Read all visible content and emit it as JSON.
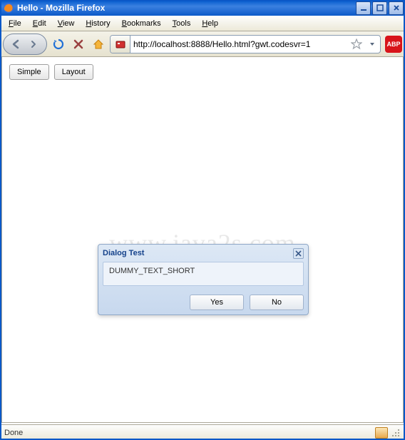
{
  "window": {
    "title": "Hello - Mozilla Firefox"
  },
  "menu": {
    "file": "File",
    "edit": "Edit",
    "view": "View",
    "history": "History",
    "bookmarks": "Bookmarks",
    "tools": "Tools",
    "help": "Help"
  },
  "toolbar": {
    "url": "http://localhost:8888/Hello.html?gwt.codesvr=1",
    "abp": "ABP"
  },
  "page": {
    "buttons": {
      "simple": "Simple",
      "layout": "Layout"
    },
    "watermark": "www.java2s.com"
  },
  "dialog": {
    "title": "Dialog Test",
    "message": "DUMMY_TEXT_SHORT",
    "yes": "Yes",
    "no": "No"
  },
  "status": {
    "text": "Done"
  }
}
